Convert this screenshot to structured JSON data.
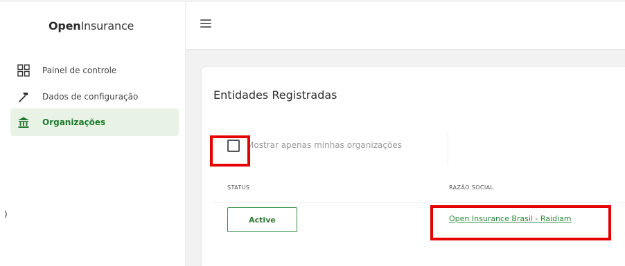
{
  "brand": {
    "bold": "Open",
    "light": "Insurance"
  },
  "sidebar": {
    "items": [
      {
        "label": "Painel de controle",
        "icon": "dashboard-icon"
      },
      {
        "label": "Dados de configuração",
        "icon": "hammer-icon"
      },
      {
        "label": "Organizações",
        "icon": "bank-icon",
        "active": true
      }
    ]
  },
  "header": {
    "menu_icon": "hamburger-menu-icon"
  },
  "main": {
    "title": "Entidades Registradas",
    "filter": {
      "label": "Mostrar apenas minhas organizações",
      "checked": false
    },
    "table": {
      "columns": [
        "STATUS",
        "RAZÃO SOCIAL"
      ],
      "rows": [
        {
          "status": "Active",
          "razao_social": "Open Insurance Brasil - Raidiam"
        }
      ]
    }
  },
  "left_edge_mark": ")",
  "colors": {
    "accent": "#2f8a3b",
    "active_bg": "#e8f3e6",
    "highlight": "#e50000"
  }
}
